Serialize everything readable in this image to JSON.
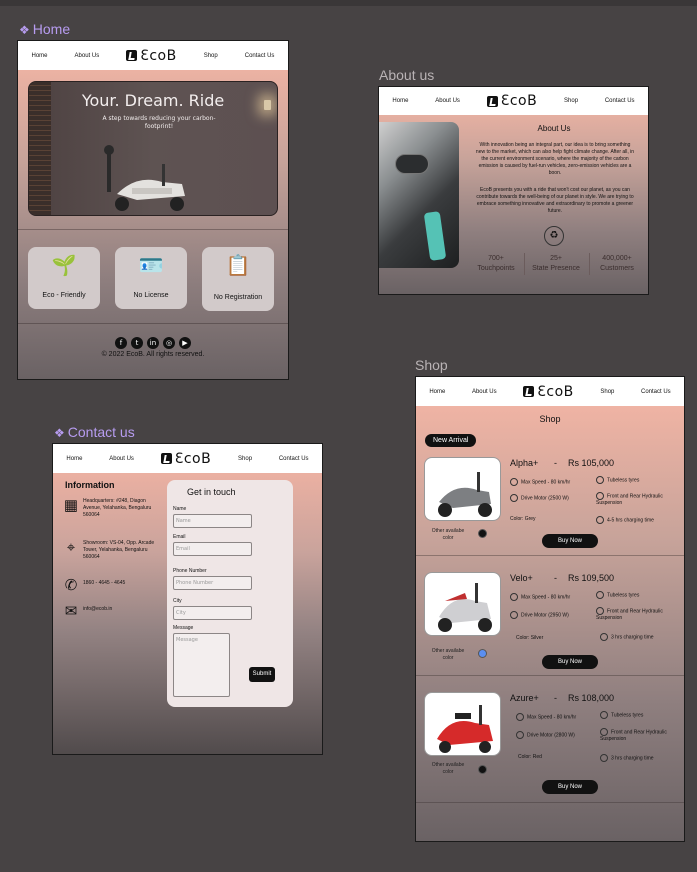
{
  "colors": {
    "canvas": "#474344",
    "label_purple": "#b79cf0",
    "label_gray": "#b9b3b5",
    "gradient_top": "#f8b7a6",
    "button": "#111111"
  },
  "nav": {
    "home": "Home",
    "about": "About Us",
    "logo": "ƐcoB",
    "shop": "Shop",
    "contact": "Contact Us"
  },
  "labels": {
    "home": "Home",
    "about": "About us",
    "contact": "Contact us",
    "shop": "Shop"
  },
  "home": {
    "hero_title": "Your. Dream. Ride",
    "hero_subtitle": "A step towards reducing your carbon-footprint!",
    "features": [
      {
        "label": "Eco - Friendly",
        "icon": "plant-hand-icon"
      },
      {
        "label": "No License",
        "icon": "id-card-icon"
      },
      {
        "label": "No Registration",
        "icon": "document-icon"
      }
    ],
    "social": [
      "facebook-icon",
      "twitter-icon",
      "linkedin-icon",
      "instagram-icon",
      "youtube-icon"
    ],
    "copyright": "© 2022 EcoB. All rights reserved."
  },
  "about": {
    "title": "About Us",
    "para1": "With innovation being an integral part, our idea is to bring something new to the market, which can also help fight climate change. After all, in the current environment scenario, where the majority of the carbon emission is caused by fuel-run vehicles, zero-emission vehicles are a boon.",
    "para2": "EcoB presents you with a ride that won't cost our planet, as you can contribute towards the well-being of our planet in style. We are trying to embrace something innovative and extraordinary to promote a greener future.",
    "stats": [
      {
        "value": "700+",
        "label": "Touchpoints"
      },
      {
        "value": "25+",
        "label": "State Presence"
      },
      {
        "value": "400,000+",
        "label": "Customers"
      }
    ]
  },
  "contact": {
    "info_title": "Information",
    "hq": "Headquarters: #248, Diagon Avenue, Yelahanka, Bengaluru 560064",
    "showroom": "Showroom: VS-04, Opp. Arcade Tower, Yelahanka, Bengaluru 560064",
    "phone": "1860 - 4645 - 4645",
    "email": "info@ecob.in",
    "form_title": "Get in touch",
    "fields": {
      "name_label": "Name",
      "name_ph": "Name",
      "email_label": "Email",
      "email_ph": "Email",
      "phone_label": "Phone Number",
      "phone_ph": "Phone Number",
      "city_label": "City",
      "city_ph": "City",
      "message_label": "Message",
      "message_ph": "Message"
    },
    "submit": "Submit"
  },
  "shop": {
    "title": "Shop",
    "badge": "New Arrival",
    "other_label": "Other availabe color",
    "buy": "Buy Now",
    "products": [
      {
        "name": "Alpha+",
        "dash": "-",
        "price": "Rs 105,000",
        "speed": "Max Speed - 80 km/hr",
        "tyres": "Tubeless tyres",
        "motor": "Drive Motor (2500 W)",
        "suspension": "Front and Rear Hydraulic Suspension",
        "color": "Color: Grey",
        "charging": "4-5 hrs charging time",
        "swatch": "#111111"
      },
      {
        "name": "Velo+",
        "dash": "-",
        "price": "Rs 109,500",
        "speed": "Max Speed - 80 km/hr",
        "tyres": "Tubeless tyres",
        "motor": "Drive Motor (2950 W)",
        "suspension": "Front and Rear Hydraulic Suspension",
        "color": "Color: Silver",
        "charging": "3 hrs charging time",
        "swatch": "#5a8ef0"
      },
      {
        "name": "Azure+",
        "dash": "-",
        "price": "Rs 108,000",
        "speed": "Max Speed - 80 km/hr",
        "tyres": "Tubeless tyres",
        "motor": "Drive Motor (2800 W)",
        "suspension": "Front and Rear Hydraulic Suspension",
        "color": "Color: Red",
        "charging": "3 hrs charging time",
        "swatch": "#111111"
      }
    ]
  }
}
